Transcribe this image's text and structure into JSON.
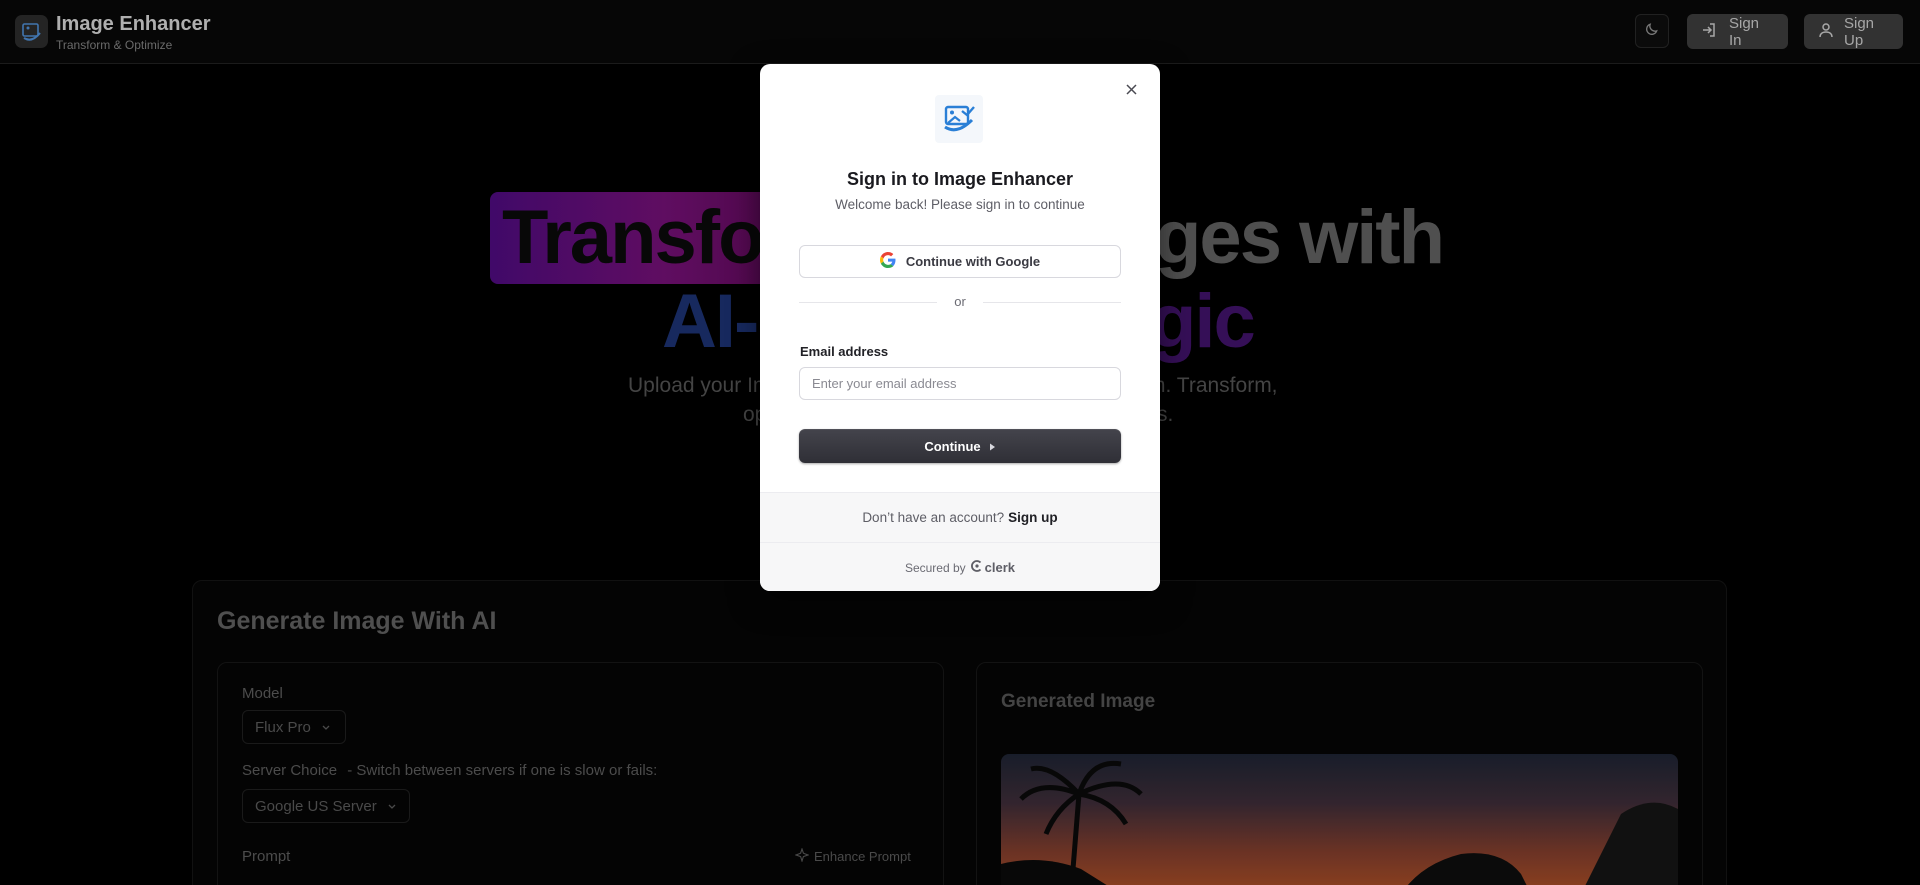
{
  "header": {
    "app_title": "Image Enhancer",
    "app_subtitle": "Transform & Optimize",
    "sign_in_label": "Sign In",
    "sign_up_label": "Sign Up",
    "logo_icon": "image-enhancer-logo-icon",
    "theme_icon": "moon-icon"
  },
  "hero": {
    "line1_left": "Transfo",
    "line1_right": "ges with",
    "line2_left": "AI-",
    "line2_right": "gic",
    "sub_line1_left": "Upload your Im",
    "sub_line1_right": "m. Transform,",
    "sub_line2_left": "op",
    "sub_line2_right": "s."
  },
  "generator": {
    "title": "Generate Image With AI",
    "model_label": "Model",
    "model_value": "Flux Pro",
    "server_label": "Server Choice",
    "server_hint": "- Switch between servers if one is slow or fails:",
    "server_value": "Google US Server",
    "prompt_label": "Prompt",
    "enhance_label": "Enhance Prompt",
    "generated_title": "Generated Image"
  },
  "modal": {
    "title": "Sign in to Image Enhancer",
    "subtitle": "Welcome back! Please sign in to continue",
    "google_label": "Continue with Google",
    "or_label": "or",
    "email_label": "Email address",
    "email_placeholder": "Enter your email address",
    "email_value": "",
    "continue_label": "Continue",
    "no_account_text": "Don’t have an account?",
    "sign_up_link": "Sign up",
    "secured_by": "Secured by",
    "clerk_label": "clerk"
  },
  "colors": {
    "accent_dark": "#2f2f36",
    "google_blue": "#4285F4",
    "google_red": "#EA4335",
    "google_yellow": "#FBBC05",
    "google_green": "#34A853",
    "logo_blue": "#2a7fd6"
  }
}
